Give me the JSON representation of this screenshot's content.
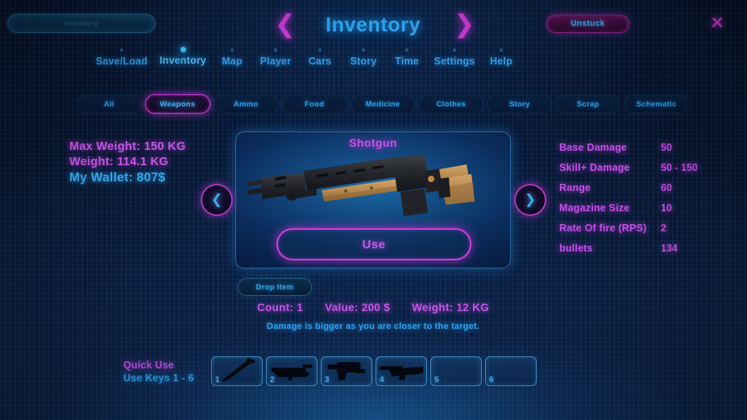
{
  "header": {
    "search_pill_text": "Inventory",
    "prev_icon": "chevron-left-icon",
    "prev_glyph": "❮",
    "title": "Inventory",
    "next_icon": "chevron-right-icon",
    "next_glyph": "❯",
    "unstuck_label": "Unstuck",
    "close_glyph": "✕"
  },
  "nav": {
    "items": [
      {
        "label": "Save/Load",
        "active": false
      },
      {
        "label": "Inventory",
        "active": true
      },
      {
        "label": "Map",
        "active": false
      },
      {
        "label": "Player",
        "active": false
      },
      {
        "label": "Cars",
        "active": false
      },
      {
        "label": "Story",
        "active": false
      },
      {
        "label": "Time",
        "active": false
      },
      {
        "label": "Settings",
        "active": false
      },
      {
        "label": "Help",
        "active": false
      }
    ]
  },
  "filter_tabs": {
    "items": [
      {
        "label": "All",
        "selected": false
      },
      {
        "label": "Weapons",
        "selected": true
      },
      {
        "label": "Ammo",
        "selected": false
      },
      {
        "label": "Food",
        "selected": false
      },
      {
        "label": "Medicine",
        "selected": false
      },
      {
        "label": "Clothes",
        "selected": false
      },
      {
        "label": "Story",
        "selected": false
      },
      {
        "label": "Scrap",
        "selected": false
      },
      {
        "label": "Schematic",
        "selected": false
      }
    ]
  },
  "left_stats": {
    "max_weight": "Max Weight: 150 KG",
    "weight": "Weight: 114.1 KG",
    "wallet": "My Wallet: 807$"
  },
  "item": {
    "name": "Shotgun",
    "sprite": "shotgun-sprite",
    "use_label": "Use",
    "drop_label": "Drop Item",
    "count": "Count: 1",
    "value": "Value: 200 $",
    "weight": "Weight: 12 KG",
    "description": "Damage is bigger as you are closer to the target.",
    "prev_glyph": "❮",
    "next_glyph": "❯"
  },
  "right_stats": {
    "rows": [
      {
        "label": "Base Damage",
        "value": "50"
      },
      {
        "label": "Skill+ Damage",
        "value": "50 - 150"
      },
      {
        "label": "Range",
        "value": "60"
      },
      {
        "label": "Magazine Size",
        "value": "10"
      },
      {
        "label": "Rate Of fire (RPS)",
        "value": "2"
      },
      {
        "label": "bullets",
        "value": "134"
      }
    ]
  },
  "quick_use": {
    "title": "Quick Use",
    "subtitle": "Use Keys 1 - 6",
    "slots": [
      {
        "num": "1",
        "icon": "melee-bat-icon",
        "filled": true
      },
      {
        "num": "2",
        "icon": "rifle-icon",
        "filled": true
      },
      {
        "num": "3",
        "icon": "smg-icon",
        "filled": true
      },
      {
        "num": "4",
        "icon": "shotgun-icon",
        "filled": true
      },
      {
        "num": "5",
        "icon": "empty-slot-icon",
        "filled": false
      },
      {
        "num": "6",
        "icon": "empty-slot-icon",
        "filled": false
      }
    ]
  },
  "colors": {
    "accent_cyan": "#2ea8f0",
    "accent_magenta": "#cf3ddd",
    "stat_magenta": "#c24fe6",
    "background_navy": "#07152e"
  }
}
